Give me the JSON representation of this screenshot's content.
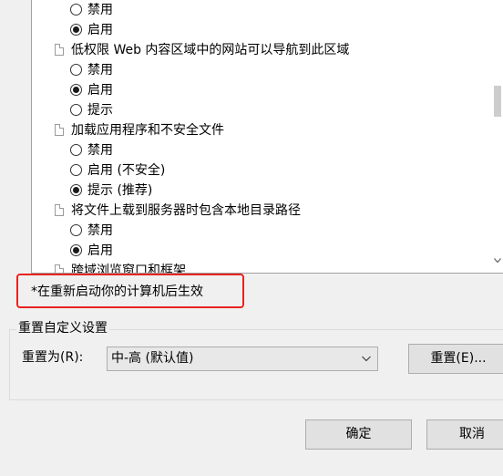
{
  "settings": {
    "items": [
      {
        "type": "option",
        "label": "禁用",
        "checked": false
      },
      {
        "type": "option",
        "label": "启用",
        "checked": true
      },
      {
        "type": "setting",
        "label": "低权限 Web 内容区域中的网站可以导航到此区域"
      },
      {
        "type": "option",
        "label": "禁用",
        "checked": false
      },
      {
        "type": "option",
        "label": "启用",
        "checked": true
      },
      {
        "type": "option",
        "label": "提示",
        "checked": false
      },
      {
        "type": "setting",
        "label": "加载应用程序和不安全文件"
      },
      {
        "type": "option",
        "label": "禁用",
        "checked": false
      },
      {
        "type": "option",
        "label": "启用 (不安全)",
        "checked": false
      },
      {
        "type": "option",
        "label": "提示 (推荐)",
        "checked": true
      },
      {
        "type": "setting",
        "label": "将文件上载到服务器时包含本地目录路径"
      },
      {
        "type": "option",
        "label": "禁用",
        "checked": false
      },
      {
        "type": "option",
        "label": "启用",
        "checked": true
      },
      {
        "type": "setting",
        "label": "跨域浏览窗口和框架"
      }
    ]
  },
  "notice": {
    "restart_text": "*在重新启动你的计算机后生效",
    "highlight_color": "#e8231f"
  },
  "reset_group": {
    "title": "重置自定义设置",
    "reset_to_label": "重置为(R):",
    "selected_level": "中-高 (默认值)",
    "reset_button": "重置(E)..."
  },
  "footer": {
    "ok_button": "确定",
    "cancel_button": "取消"
  }
}
